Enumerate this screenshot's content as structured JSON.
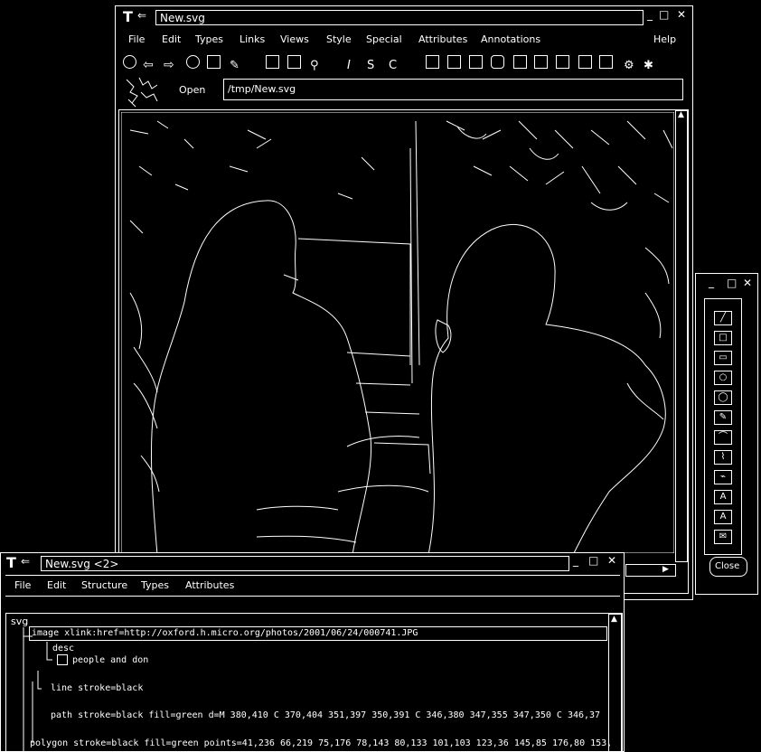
{
  "main_window": {
    "title": "New.svg",
    "logo_text": "T",
    "controls": [
      "_",
      "□",
      "✕"
    ],
    "menu": [
      "File",
      "Edit",
      "Types",
      "Links",
      "Views",
      "Style",
      "Special",
      "Attributes",
      "Annotations"
    ],
    "help": "Help",
    "open_label": "Open",
    "path_value": "/tmp/New.svg"
  },
  "palette": {
    "controls": [
      "_",
      "□",
      "✕"
    ],
    "tools": [
      "╱",
      "□",
      "▭",
      "○",
      "◯",
      "✎",
      "⌒",
      "⌇",
      "⌁",
      "A",
      "A",
      "✉"
    ],
    "close_label": "Close"
  },
  "structure_window": {
    "title": "New.svg <2>",
    "controls": [
      "_",
      "□",
      "✕"
    ],
    "menu": [
      "File",
      "Edit",
      "Structure",
      "Types",
      "Attributes"
    ],
    "root": "svg",
    "lines": [
      "image xlink:href=http://oxford.h.micro.org/photos/2001/06/24/000741.JPG",
      "desc",
      "people and don",
      "line stroke=black",
      "path stroke=black fill=green d=M 380,410 C 370,404 351,397 350,391 C 346,380 347,355 347,350 C 346,37",
      "polygon stroke=black fill=green points=41,236 66,219 75,176 78,143 80,133 101,103 123,36 145,85 176,80 153,"
    ]
  },
  "colors": {
    "background": "#000000",
    "line": "#ffffff"
  }
}
